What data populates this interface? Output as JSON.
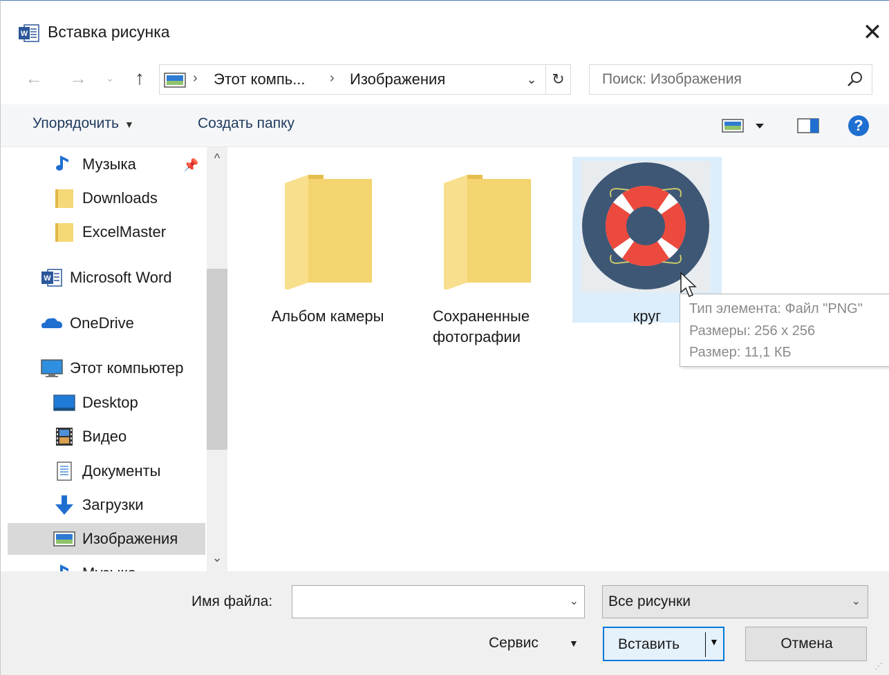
{
  "window": {
    "title": "Вставка рисунка",
    "app_icon": "word-icon",
    "close_glyph": "✕"
  },
  "nav": {
    "back": "←",
    "forward": "→",
    "recent": "⌄",
    "up": "↑"
  },
  "address": {
    "sep1": "›",
    "crumb1": "Этот компь...",
    "sep2": "›",
    "crumb2": "Изображения",
    "dropdown": "⌄",
    "refresh": "↻"
  },
  "search": {
    "placeholder": "Поиск: Изображения"
  },
  "toolbar": {
    "organize": "Упорядочить",
    "organize_caret": "▼",
    "new_folder": "Создать папку",
    "help": "?"
  },
  "sidebar": {
    "items": [
      {
        "label": "Музыка",
        "icon": "music-icon"
      },
      {
        "label": "Downloads",
        "icon": "folder-icon"
      },
      {
        "label": "ExcelMaster",
        "icon": "folder-icon"
      },
      {
        "label": "Microsoft Word",
        "icon": "word-icon"
      },
      {
        "label": "OneDrive",
        "icon": "cloud-icon"
      },
      {
        "label": "Этот компьютер",
        "icon": "computer-icon"
      },
      {
        "label": "Desktop",
        "icon": "desktop-icon"
      },
      {
        "label": "Видео",
        "icon": "video-icon"
      },
      {
        "label": "Документы",
        "icon": "documents-icon"
      },
      {
        "label": "Загрузки",
        "icon": "download-arrow-icon"
      },
      {
        "label": "Изображения",
        "icon": "pictures-icon",
        "selected": true
      },
      {
        "label": "Музыка",
        "icon": "music-icon"
      }
    ],
    "pin": "📌",
    "scroll_up": "^",
    "scroll_down": "⌄"
  },
  "files": [
    {
      "name": "Альбом камеры",
      "type": "folder"
    },
    {
      "name_line1": "Сохраненные",
      "name_line2": "фотографии",
      "type": "folder"
    },
    {
      "name": "круг",
      "type": "image",
      "selected": true
    }
  ],
  "tooltip": {
    "line1": "Тип элемента: Файл \"PNG\"",
    "line2": "Размеры: 256 x 256",
    "line3": "Размер: 11,1 КБ"
  },
  "bottom": {
    "filename_label": "Имя файла:",
    "filename_value": "",
    "filename_caret": "⌄",
    "filter_value": "Все рисунки",
    "filter_caret": "⌄",
    "service_label": "Сервис",
    "service_caret": "▼",
    "insert_label": "Вставить",
    "insert_caret": "▼",
    "cancel_label": "Отмена",
    "grip": "⋰"
  },
  "colors": {
    "accent": "#0078d7",
    "selection": "#dceefc",
    "lifebuoy_bg": "#3e5775",
    "lifebuoy_red": "#ec4a3e",
    "folder_yellow": "#f5d877"
  }
}
